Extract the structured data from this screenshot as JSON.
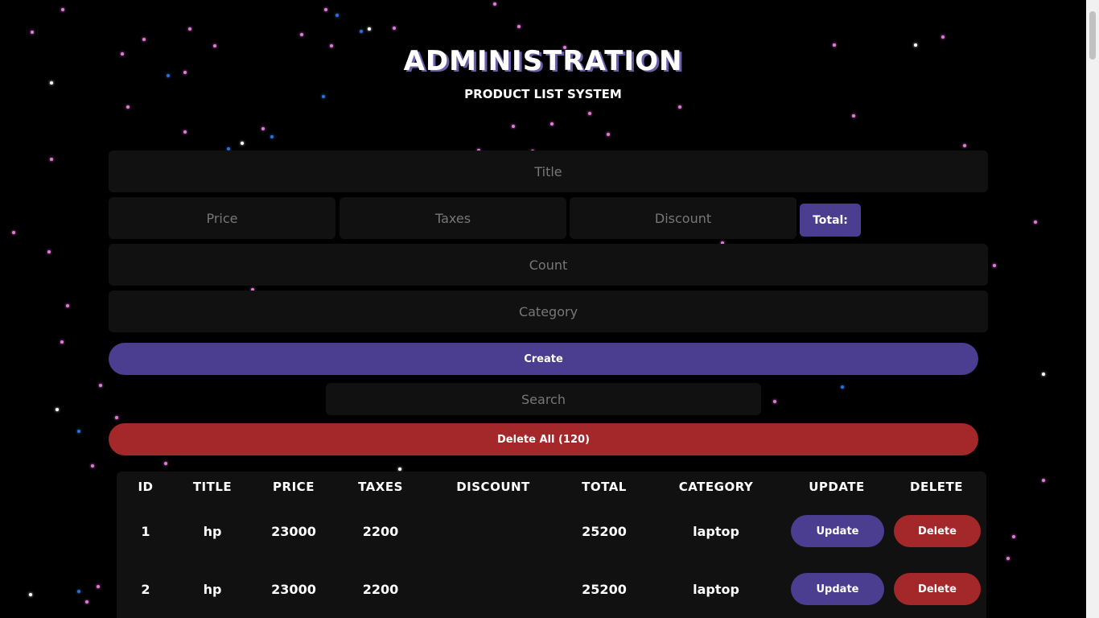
{
  "header": {
    "title": "ADMINISTRATION",
    "subtitle": "PRODUCT LIST SYSTEM"
  },
  "form": {
    "title_placeholder": "Title",
    "price_placeholder": "Price",
    "taxes_placeholder": "Taxes",
    "discount_placeholder": "Discount",
    "total_label": "Total:",
    "count_placeholder": "Count",
    "category_placeholder": "Category",
    "create_label": "Create",
    "search_placeholder": "Search",
    "delete_all_label": "Delete All (120)"
  },
  "table": {
    "headers": [
      "ID",
      "TITLE",
      "PRICE",
      "TAXES",
      "DISCOUNT",
      "TOTAL",
      "CATEGORY",
      "UPDATE",
      "DELETE"
    ],
    "rows": [
      {
        "id": "1",
        "title": "hp",
        "price": "23000",
        "taxes": "2200",
        "discount": "",
        "total": "25200",
        "category": "laptop",
        "update": "Update",
        "delete": "Delete"
      },
      {
        "id": "2",
        "title": "hp",
        "price": "23000",
        "taxes": "2200",
        "discount": "",
        "total": "25200",
        "category": "laptop",
        "update": "Update",
        "delete": "Delete"
      }
    ]
  },
  "colors": {
    "background": "#000000",
    "field": "#111111",
    "purple_button": "#4b3d8f",
    "red_button": "#a4282a",
    "star_pink": "#e07ad8",
    "star_blue": "#2a6fd8",
    "star_white": "#ffffff"
  }
}
